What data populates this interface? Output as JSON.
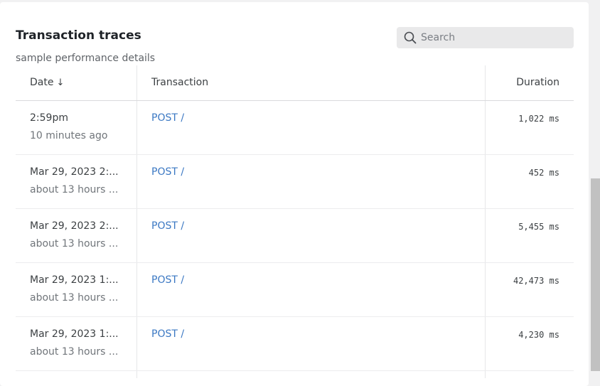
{
  "panel": {
    "title": "Transaction traces",
    "subtitle": "sample performance details"
  },
  "search": {
    "placeholder": "Search",
    "value": ""
  },
  "table": {
    "headers": {
      "date": "Date",
      "date_sort_indicator": "↓",
      "transaction": "Transaction",
      "duration": "Duration"
    },
    "rows": [
      {
        "date": "2:59pm",
        "relative": "10 minutes ago",
        "transaction": "POST /",
        "duration": "1,022 ms"
      },
      {
        "date": "Mar 29, 2023 2:...",
        "relative": "about 13 hours ...",
        "transaction": "POST /",
        "duration": "452 ms"
      },
      {
        "date": "Mar 29, 2023 2:...",
        "relative": "about 13 hours ...",
        "transaction": "POST /",
        "duration": "5,455 ms"
      },
      {
        "date": "Mar 29, 2023 1:...",
        "relative": "about 13 hours ...",
        "transaction": "POST /",
        "duration": "42,473 ms"
      },
      {
        "date": "Mar 29, 2023 1:...",
        "relative": "about 13 hours ...",
        "transaction": "POST /",
        "duration": "4,230 ms"
      }
    ]
  },
  "colors": {
    "link": "#3b78c3",
    "scrollbar_thumb": "#c1c1c1"
  },
  "icons": {
    "search": "search-icon",
    "sort": "arrow-down-icon"
  }
}
